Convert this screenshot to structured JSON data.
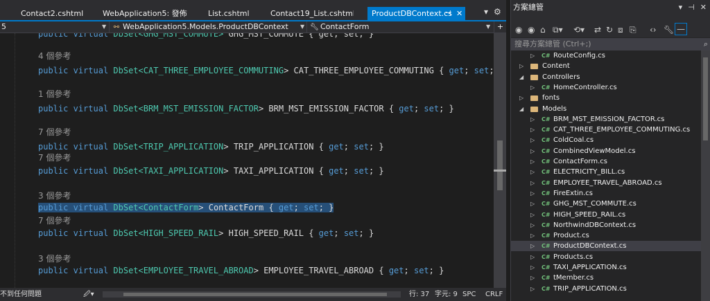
{
  "tabs": [
    {
      "label": "Contact2.cshtml"
    },
    {
      "label": "WebApplication5: 發佈"
    },
    {
      "label": "List.cshtml"
    },
    {
      "label": "Contact19_List.cshtml"
    },
    {
      "label": "ProductDBContext.cs",
      "active": true
    }
  ],
  "tab_icons": {
    "pin": "pin-icon",
    "close": "close-icon",
    "dropdown": "chevron-down-icon",
    "settings": "gear-icon"
  },
  "navbar": {
    "left": "5",
    "project": "WebApplication5.Models.ProductDBContext",
    "member": "ContactForm"
  },
  "code": {
    "partial_top": {
      "kw": "public virtual ",
      "ty": "DbSet<GHG_MST_COMMUTE>",
      "rest": " GHG_MST_COMMUTE { get; set; }"
    },
    "blocks": [
      {
        "ref": "4 個參考",
        "type": "CAT_THREE_EMPLOYEE_COMMUTING",
        "name": "CAT_THREE_EMPLOYEE_COMMUTING"
      },
      {
        "ref": "1 個參考",
        "type": "BRM_MST_EMISSION_FACTOR",
        "name": "BRM_MST_EMISSION_FACTOR"
      },
      {
        "ref": "7 個參考",
        "type": "TRIP_APPLICATION",
        "name": "TRIP_APPLICATION"
      },
      {
        "ref": "7 個參考",
        "type": "TAXI_APPLICATION",
        "name": "TAXI_APPLICATION"
      },
      {
        "ref": "3 個參考",
        "type": "ContactForm",
        "name": "ContactForm"
      },
      {
        "ref": "7 個參考",
        "type": "HIGH_SPEED_RAIL",
        "name": "HIGH_SPEED_RAIL"
      },
      {
        "ref": "3 個參考",
        "type": "EMPLOYEE_TRAVEL_ABROAD",
        "name": "EMPLOYEE_TRAVEL_ABROAD"
      }
    ],
    "kw_public": "public",
    "kw_virtual": "virtual",
    "dbset_open": "DbSet<",
    "dbset_close": ">",
    "accessor": "{ get; set; }",
    "kw_get": "get",
    "kw_set": "set"
  },
  "status": {
    "message": "不到任何問題",
    "line": "行: 37",
    "col": "字元: 9",
    "mode": "SPC",
    "eol": "CRLF"
  },
  "solution": {
    "title": "方案總管",
    "search_placeholder": "搜尋方案總管 (Ctrl+;)",
    "items": [
      {
        "label": "RouteConfig.cs",
        "kind": "cs",
        "indent": 3,
        "arrow": "right"
      },
      {
        "label": "Content",
        "kind": "folder",
        "indent": 2,
        "arrow": "right"
      },
      {
        "label": "Controllers",
        "kind": "folder",
        "indent": 2,
        "arrow": "down"
      },
      {
        "label": "HomeController.cs",
        "kind": "cs",
        "indent": 3,
        "arrow": "right"
      },
      {
        "label": "fonts",
        "kind": "folder",
        "indent": 2,
        "arrow": "right"
      },
      {
        "label": "Models",
        "kind": "folder",
        "indent": 2,
        "arrow": "down"
      },
      {
        "label": "BRM_MST_EMISSION_FACTOR.cs",
        "kind": "cs",
        "indent": 3,
        "arrow": "right"
      },
      {
        "label": "CAT_THREE_EMPLOYEE_COMMUTING.cs",
        "kind": "cs",
        "indent": 3,
        "arrow": "right"
      },
      {
        "label": "ColdCoal.cs",
        "kind": "cs",
        "indent": 3,
        "arrow": "right"
      },
      {
        "label": "CombinedViewModel.cs",
        "kind": "cs",
        "indent": 3,
        "arrow": "right"
      },
      {
        "label": "ContactForm.cs",
        "kind": "cs",
        "indent": 3,
        "arrow": "right"
      },
      {
        "label": "ELECTRICITY_BILL.cs",
        "kind": "cs",
        "indent": 3,
        "arrow": "right"
      },
      {
        "label": "EMPLOYEE_TRAVEL_ABROAD.cs",
        "kind": "cs",
        "indent": 3,
        "arrow": "right"
      },
      {
        "label": "FireExtin.cs",
        "kind": "cs",
        "indent": 3,
        "arrow": "right"
      },
      {
        "label": "GHG_MST_COMMUTE.cs",
        "kind": "cs",
        "indent": 3,
        "arrow": "right"
      },
      {
        "label": "HIGH_SPEED_RAIL.cs",
        "kind": "cs",
        "indent": 3,
        "arrow": "right"
      },
      {
        "label": "NorthwindDBContext.cs",
        "kind": "cs",
        "indent": 3,
        "arrow": "right"
      },
      {
        "label": "Product.cs",
        "kind": "cs",
        "indent": 3,
        "arrow": "right"
      },
      {
        "label": "ProductDBContext.cs",
        "kind": "cs",
        "indent": 3,
        "arrow": "right",
        "selected": true
      },
      {
        "label": "Products.cs",
        "kind": "cs",
        "indent": 3,
        "arrow": "right"
      },
      {
        "label": "TAXI_APPLICATION.cs",
        "kind": "cs",
        "indent": 3,
        "arrow": "right"
      },
      {
        "label": "tMember.cs",
        "kind": "cs",
        "indent": 3,
        "arrow": "right"
      },
      {
        "label": "TRIP_APPLICATION.cs",
        "kind": "cs",
        "indent": 3,
        "arrow": "right"
      }
    ]
  },
  "colors": {
    "accent": "#007acc",
    "keyword": "#569cd6",
    "type": "#4ec9b0",
    "selection": "#264f78"
  }
}
